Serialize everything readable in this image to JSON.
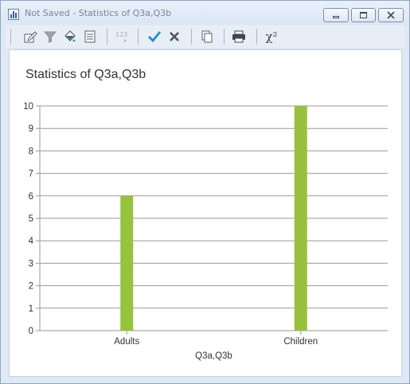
{
  "window": {
    "title": "Not Saved - Statistics of Q3a,Q3b",
    "controls": [
      "minimize-icon",
      "maximize-icon",
      "close-icon"
    ]
  },
  "toolbar": {
    "items": [
      "edit-properties-icon",
      "filter-icon",
      "fill-color-icon",
      "notes-icon",
      "number-format-icon",
      "check-icon",
      "cross-icon",
      "copy-icon",
      "print-icon",
      "chi-square-icon"
    ],
    "number_format_label": "123",
    "chi_square_label": "χ²"
  },
  "colors": {
    "bar": "#97c23c",
    "grid": "#999999",
    "accept": "#1d8fd1",
    "reject": "#4a5563"
  },
  "chart_data": {
    "type": "bar",
    "title": "Statistics of Q3a,Q3b",
    "xlabel": "Q3a,Q3b",
    "ylabel": "",
    "categories": [
      "Adults",
      "Children"
    ],
    "values": [
      6,
      10
    ],
    "ylim": [
      0,
      10
    ],
    "yticks": [
      0,
      1,
      2,
      3,
      4,
      5,
      6,
      7,
      8,
      9,
      10
    ],
    "grid": true,
    "legend": "none"
  }
}
